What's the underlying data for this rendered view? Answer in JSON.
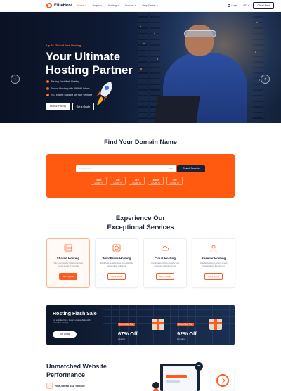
{
  "header": {
    "brand": "EliteHost",
    "nav": [
      {
        "label": "Home",
        "active": true
      },
      {
        "label": "Pages",
        "active": false
      },
      {
        "label": "Hosting",
        "active": false
      },
      {
        "label": "Domain",
        "active": false
      },
      {
        "label": "Help Center",
        "active": false
      }
    ],
    "login": "Login",
    "currency": "USD",
    "client_area": "Client Area"
  },
  "hero": {
    "promo": "Up To 75% off Web Hosting",
    "title": "Your Ultimate Hosting Partner",
    "features": [
      "Blazing Fast Web Hosting",
      "Secure Hosting with 99.9% Uptime",
      "24/7 Expert Support for Your Website"
    ],
    "primary_button": "Plan & Pricing",
    "secondary_button": "Get a Quote",
    "prev_icon": "chevron-left-icon",
    "next_icon": "chevron-right-icon"
  },
  "domain": {
    "title": "Find Your Domain Name",
    "placeholder": "Domain name",
    "tld_select": ".com",
    "search_button": "Search Domain",
    "tlds": [
      {
        "ext": ".com",
        "price": "only $9.75"
      },
      {
        "ext": ".net",
        "price": "only $9.75"
      },
      {
        "ext": ".org",
        "price": "only $9.75"
      },
      {
        "ext": ".store",
        "price": "only $9.75"
      },
      {
        "ext": ".xyz",
        "price": "only $9.75"
      }
    ]
  },
  "services": {
    "title_line1": "Experience Our",
    "title_line2": "Exceptional Services",
    "cards": [
      {
        "title": "Shared Hosting",
        "desc": "The most popular hosting plan and comes at one of the most",
        "button": "Get a Quote",
        "icon": "server-icon"
      },
      {
        "title": "WordPress Hosting",
        "desc": "WordPress Hosting gives you optimized performance with a full",
        "button": "Get a Quote",
        "icon": "wordpress-icon"
      },
      {
        "title": "Cloud Hosting",
        "desc": "Your infrastructure to register your resources with easy to use",
        "button": "Get a Quote",
        "icon": "cloud-icon"
      },
      {
        "title": "Reseller Hosting",
        "desc": "Reseller hosting is a form of web hosting where the account",
        "button": "Get a Quote",
        "icon": "users-icon"
      }
    ]
  },
  "flash": {
    "title": "Hosting Flash Sale",
    "subtitle": "For a limited time, launch your website with incredible savings.",
    "button": "Get Deals",
    "offers": [
      {
        "tag": "For a Limited Time",
        "percent": "67% Off",
        "name": "Hosting"
      },
      {
        "tag": "For a Limited Time",
        "percent": "92% Off",
        "name": "Domains"
      }
    ]
  },
  "why": {
    "title": "Unmatched Website Performance",
    "feature": "High-Speed SSD Storage"
  },
  "colors": {
    "accent": "#ff5a1f",
    "navy": "#16213a",
    "hero_bg": "#0e1a33"
  }
}
